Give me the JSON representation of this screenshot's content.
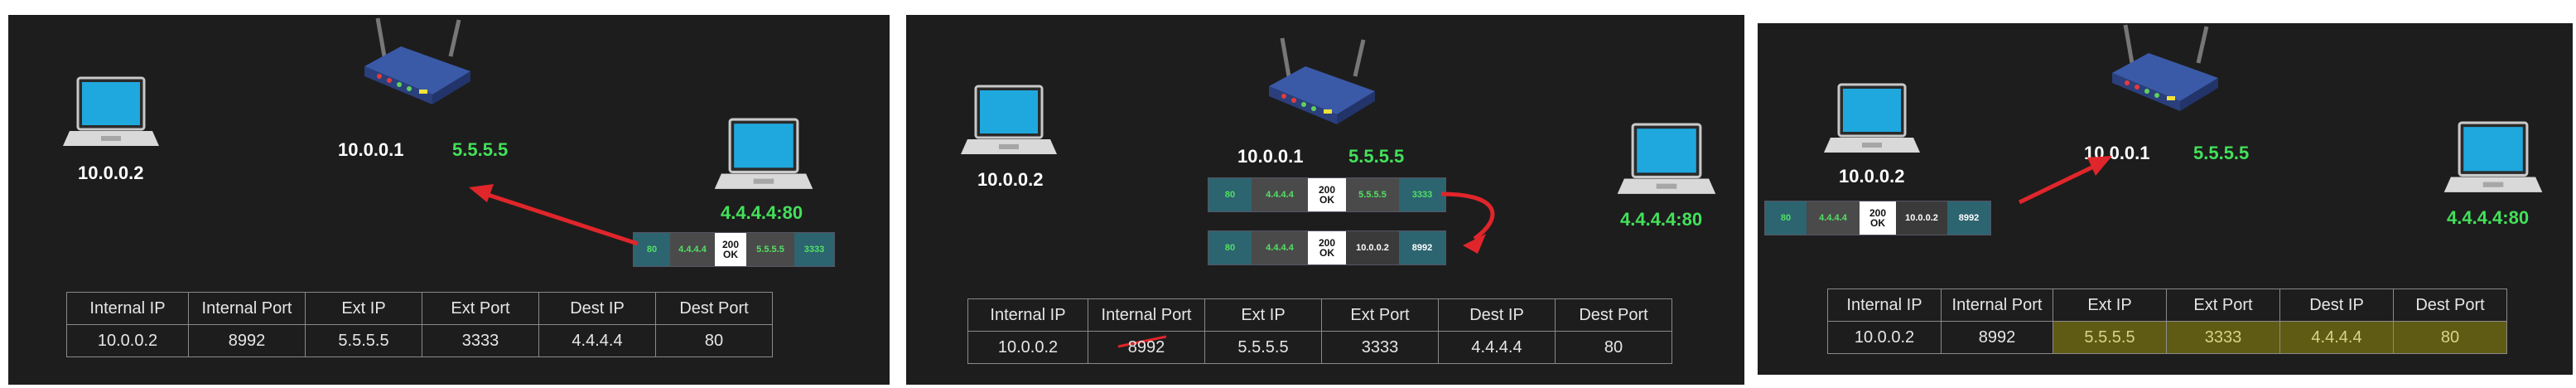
{
  "panels": [
    {
      "left_laptop_ip": "10.0.0.2",
      "router_private_ip": "10.0.0.1",
      "router_public_ip": "5.5.5.5",
      "server_ip": "4.4.4.4:80",
      "packets": [
        {
          "segments": [
            "80",
            "4.4.4.4",
            "200 OK",
            "5.5.5.5",
            "3333"
          ]
        }
      ],
      "table": {
        "headers": [
          "Internal IP",
          "Internal Port",
          "Ext IP",
          "Ext Port",
          "Dest IP",
          "Dest Port"
        ],
        "row": [
          "10.0.0.2",
          "8992",
          "5.5.5.5",
          "3333",
          "4.4.4.4",
          "80"
        ]
      }
    },
    {
      "left_laptop_ip": "10.0.0.2",
      "router_private_ip": "10.0.0.1",
      "router_public_ip": "5.5.5.5",
      "server_ip": "4.4.4.4:80",
      "packets": [
        {
          "segments": [
            "80",
            "4.4.4.4",
            "200 OK",
            "5.5.5.5",
            "3333"
          ]
        },
        {
          "segments": [
            "80",
            "4.4.4.4",
            "200 OK",
            "10.0.0.2",
            "8992"
          ]
        }
      ],
      "table": {
        "headers": [
          "Internal IP",
          "Internal Port",
          "Ext IP",
          "Ext Port",
          "Dest IP",
          "Dest Port"
        ],
        "row": [
          "10.0.0.2",
          "8992",
          "5.5.5.5",
          "3333",
          "4.4.4.4",
          "80"
        ]
      }
    },
    {
      "left_laptop_ip": "10.0.0.2",
      "router_private_ip": "10.0.0.1",
      "router_public_ip": "5.5.5.5",
      "server_ip": "4.4.4.4:80",
      "packets": [
        {
          "segments": [
            "80",
            "4.4.4.4",
            "200 OK",
            "10.0.0.2",
            "8992"
          ]
        }
      ],
      "table": {
        "headers": [
          "Internal IP",
          "Internal Port",
          "Ext IP",
          "Ext Port",
          "Dest IP",
          "Dest Port"
        ],
        "row": [
          "10.0.0.2",
          "8992",
          "5.5.5.5",
          "3333",
          "4.4.4.4",
          "80"
        ]
      }
    }
  ],
  "colors": {
    "background": "#1d1d1d",
    "public_ip_green": "#43e15a",
    "arrow_red": "#e0262b",
    "highlight": "#5f5b14"
  }
}
